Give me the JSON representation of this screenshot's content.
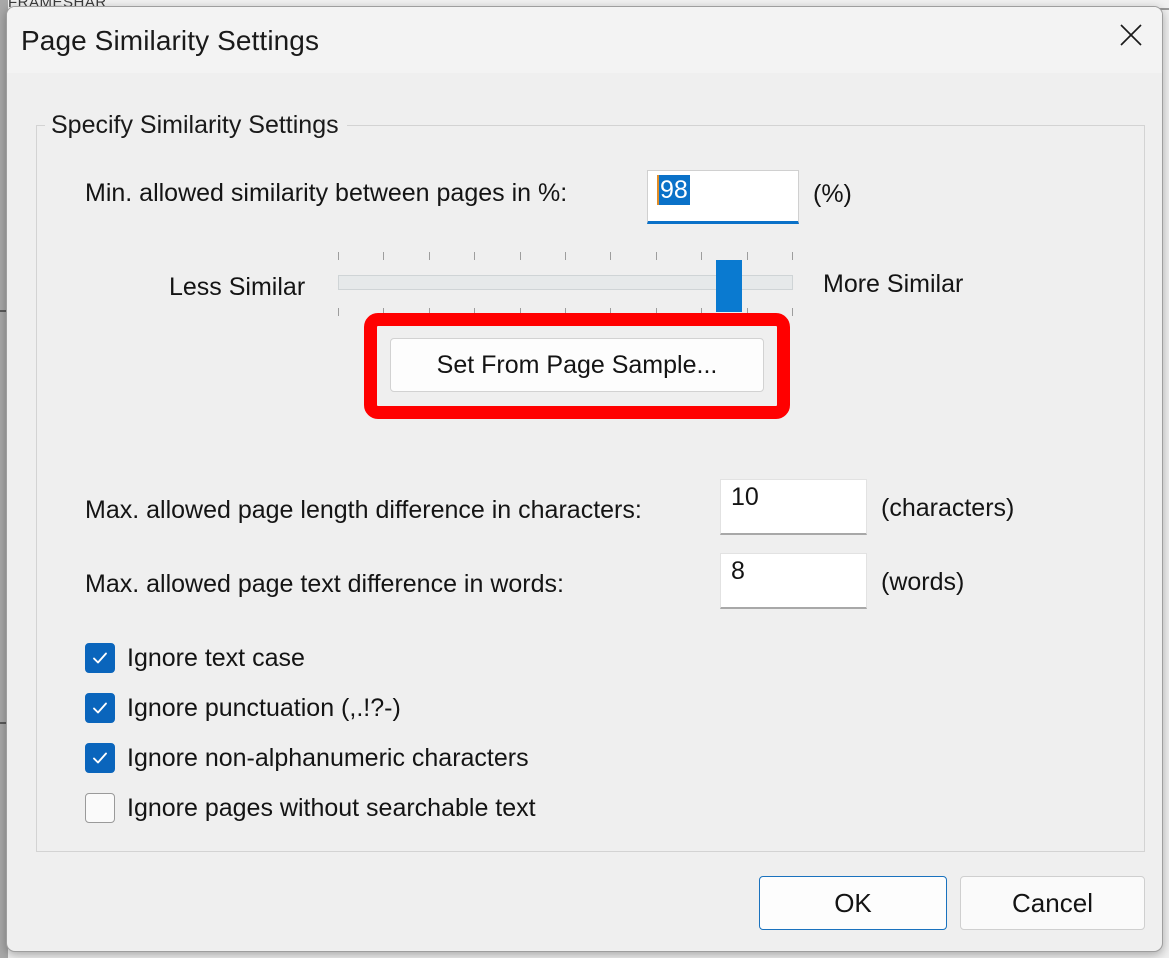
{
  "window": {
    "title": "Page Similarity Settings",
    "close_icon": "close-icon"
  },
  "background": {
    "partial_tab_text": "FRAMESHAR"
  },
  "group": {
    "legend": "Specify Similarity Settings"
  },
  "min_similarity": {
    "label": "Min. allowed similarity between pages in %:",
    "value": "98",
    "unit": "(%)",
    "selected": true
  },
  "slider": {
    "less_label": "Less Similar",
    "more_label": "More Similar",
    "value": 98,
    "min": 0,
    "max": 100,
    "tick_count": 11,
    "thumb_position_percent": 88,
    "accent_color": "#0a7ad0"
  },
  "sample_button": {
    "label": "Set From Page Sample...",
    "annotation_color": "#ff0000",
    "annotated": true
  },
  "max_chars": {
    "label": "Max. allowed page length difference in characters:",
    "value": "10",
    "unit": "(characters)"
  },
  "max_words": {
    "label": "Max. allowed page text difference in words:",
    "value": "8",
    "unit": "(words)"
  },
  "checkboxes": [
    {
      "label": "Ignore text case",
      "checked": true
    },
    {
      "label": "Ignore punctuation (,.!?-)",
      "checked": true
    },
    {
      "label": "Ignore non-alphanumeric characters",
      "checked": true
    },
    {
      "label": "Ignore pages without searchable text",
      "checked": false
    }
  ],
  "footer": {
    "ok_label": "OK",
    "cancel_label": "Cancel",
    "default_button": "OK"
  },
  "colors": {
    "dialog_background": "#efefef",
    "titlebar_background": "#f3f3f3",
    "accent": "#0a65bc",
    "selection": "#0a71c8",
    "annotation": "#ff0000"
  }
}
